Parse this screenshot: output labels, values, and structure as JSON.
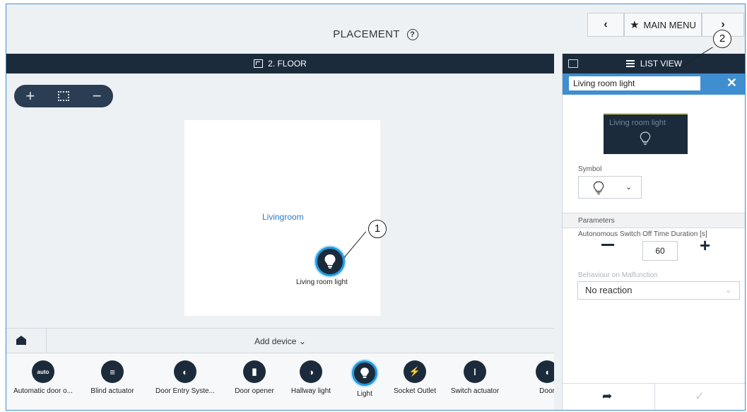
{
  "header": {
    "title": "PLACEMENT",
    "prev_label": "‹",
    "main_menu_label": "MAIN MENU",
    "next_label": "›"
  },
  "floor": {
    "label": "2. FLOOR"
  },
  "zoom": {
    "in": "+",
    "out": "−"
  },
  "room": {
    "name": "Livingroom",
    "device_label": "Living room light"
  },
  "add_device": {
    "label": "Add device",
    "chevron": "⌄"
  },
  "tray": {
    "items": [
      {
        "label": "Automatic door o...",
        "icon": "auto-key-icon",
        "glyph": "auto"
      },
      {
        "label": "Blind actuator",
        "icon": "blind-icon",
        "glyph": "≡"
      },
      {
        "label": "Door Entry Syste...",
        "icon": "door-entry-icon",
        "glyph": "◐"
      },
      {
        "label": "Door opener",
        "icon": "door-icon",
        "glyph": "▮"
      },
      {
        "label": "Hallway light",
        "icon": "hallway-light-icon",
        "glyph": "◑"
      },
      {
        "label": "Light",
        "icon": "bulb-icon",
        "glyph": "💡"
      },
      {
        "label": "Socket Outlet",
        "icon": "socket-icon",
        "glyph": "⚡"
      },
      {
        "label": "Switch actuator",
        "icon": "switch-icon",
        "glyph": "ǀ"
      },
      {
        "label": "Door",
        "icon": "door-partial-icon",
        "glyph": "◖"
      }
    ]
  },
  "panel": {
    "header": "LIST VIEW",
    "name_value": "Living room light",
    "close": "✕",
    "tile_label": "Living room light",
    "symbol_label": "Symbol",
    "parameters_label": "Parameters",
    "switch_off_label": "Autonomous Switch Off Time Duration [s]",
    "switch_off_value": "60",
    "plus": "+",
    "malfunction_label": "Behaviour on Malfunction",
    "malfunction_value": "No reaction",
    "back": "➦",
    "ok": "✓"
  },
  "callouts": [
    "1",
    "2"
  ],
  "colors": {
    "accent": "#1f9be0",
    "dark": "#1b2b3b",
    "panel_blue": "#3e8ed0",
    "room_label": "#2c7dc6"
  }
}
